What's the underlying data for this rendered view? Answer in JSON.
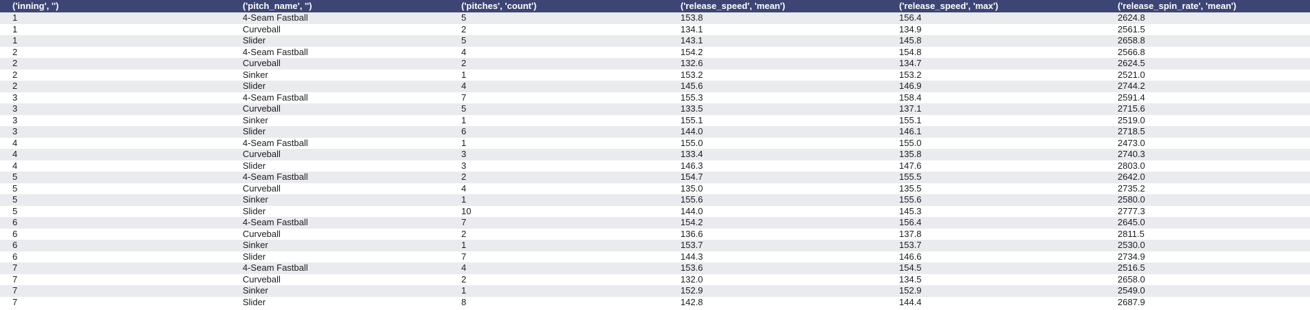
{
  "table": {
    "columns": [
      "('inning', '')",
      "('pitch_name', '')",
      "('pitches', 'count')",
      "('release_speed', 'mean')",
      "('release_speed', 'max')",
      "('release_spin_rate', 'mean')"
    ],
    "rows": [
      [
        "1",
        "4-Seam Fastball",
        "5",
        "153.8",
        "156.4",
        "2624.8"
      ],
      [
        "1",
        "Curveball",
        "2",
        "134.1",
        "134.9",
        "2561.5"
      ],
      [
        "1",
        "Slider",
        "5",
        "143.1",
        "145.8",
        "2658.8"
      ],
      [
        "2",
        "4-Seam Fastball",
        "4",
        "154.2",
        "154.8",
        "2566.8"
      ],
      [
        "2",
        "Curveball",
        "2",
        "132.6",
        "134.7",
        "2624.5"
      ],
      [
        "2",
        "Sinker",
        "1",
        "153.2",
        "153.2",
        "2521.0"
      ],
      [
        "2",
        "Slider",
        "4",
        "145.6",
        "146.9",
        "2744.2"
      ],
      [
        "3",
        "4-Seam Fastball",
        "7",
        "155.3",
        "158.4",
        "2591.4"
      ],
      [
        "3",
        "Curveball",
        "5",
        "133.5",
        "137.1",
        "2715.6"
      ],
      [
        "3",
        "Sinker",
        "1",
        "155.1",
        "155.1",
        "2519.0"
      ],
      [
        "3",
        "Slider",
        "6",
        "144.0",
        "146.1",
        "2718.5"
      ],
      [
        "4",
        "4-Seam Fastball",
        "1",
        "155.0",
        "155.0",
        "2473.0"
      ],
      [
        "4",
        "Curveball",
        "3",
        "133.4",
        "135.8",
        "2740.3"
      ],
      [
        "4",
        "Slider",
        "3",
        "146.3",
        "147.6",
        "2803.0"
      ],
      [
        "5",
        "4-Seam Fastball",
        "2",
        "154.7",
        "155.5",
        "2642.0"
      ],
      [
        "5",
        "Curveball",
        "4",
        "135.0",
        "135.5",
        "2735.2"
      ],
      [
        "5",
        "Sinker",
        "1",
        "155.6",
        "155.6",
        "2580.0"
      ],
      [
        "5",
        "Slider",
        "10",
        "144.0",
        "145.3",
        "2777.3"
      ],
      [
        "6",
        "4-Seam Fastball",
        "7",
        "154.2",
        "156.4",
        "2645.0"
      ],
      [
        "6",
        "Curveball",
        "2",
        "136.6",
        "137.8",
        "2811.5"
      ],
      [
        "6",
        "Sinker",
        "1",
        "153.7",
        "153.7",
        "2530.0"
      ],
      [
        "6",
        "Slider",
        "7",
        "144.3",
        "146.6",
        "2734.9"
      ],
      [
        "7",
        "4-Seam Fastball",
        "4",
        "153.6",
        "154.5",
        "2516.5"
      ],
      [
        "7",
        "Curveball",
        "2",
        "132.0",
        "134.5",
        "2658.0"
      ],
      [
        "7",
        "Sinker",
        "1",
        "152.9",
        "152.9",
        "2549.0"
      ],
      [
        "7",
        "Slider",
        "8",
        "142.8",
        "144.4",
        "2687.9"
      ]
    ]
  },
  "colors": {
    "header_background": "#3c4574",
    "header_text": "#ffffff",
    "row_stripe": "#e9ebef",
    "row_plain": "#ffffff"
  }
}
